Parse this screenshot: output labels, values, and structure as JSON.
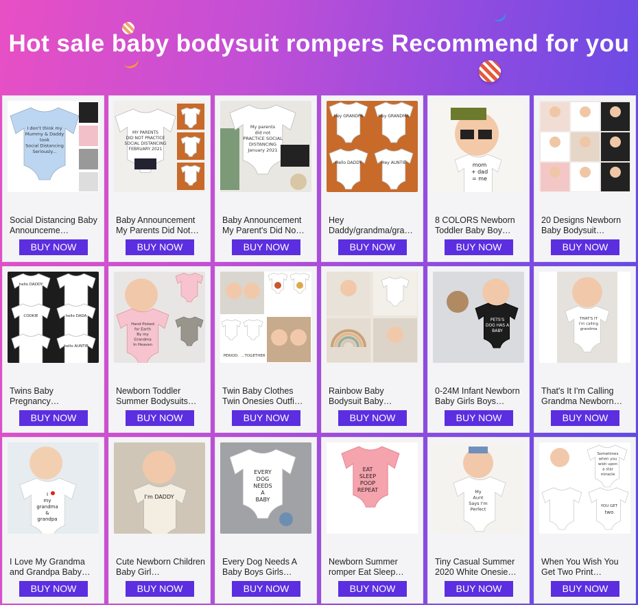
{
  "banner": {
    "title": "Hot sale baby bodysuit rompers Recommend for you",
    "colors": {
      "gradient_start": "#e84fc4",
      "gradient_end": "#5a4be6",
      "button": "#5b2ee0"
    }
  },
  "products": [
    {
      "name": "Social Distancing Baby Announceme…",
      "button": "BUY NOW",
      "image_icon": "product-photo",
      "art": "blue",
      "text": [
        "I don't think my",
        "Mummy & Daddy",
        "took",
        "Social Distancing",
        "Seriously..."
      ]
    },
    {
      "name": "Baby Announcement My Parents Did Not…",
      "button": "BUY NOW",
      "image_icon": "product-photo",
      "art": "white-orange",
      "text": [
        "MY PARENTS",
        "DID NOT PRACTICE",
        "SOCIAL DISTANCING",
        "FEBRUARY 2021"
      ]
    },
    {
      "name": "Baby Announcement My Parent's Did No…",
      "button": "BUY NOW",
      "image_icon": "product-photo",
      "art": "white-leaf",
      "text": [
        "My parents",
        "did not",
        "PRACTICE SOCIAL",
        "DISTANCING",
        "January 2021"
      ]
    },
    {
      "name": "Hey Daddy/grandma/gra…",
      "button": "BUY NOW",
      "image_icon": "product-photo",
      "art": "grid-orange",
      "text": [
        "Hey GRANDPA",
        "Hey GRANDMA",
        "Hello DADDY",
        "Hey AUNTIE"
      ]
    },
    {
      "name": "8 COLORS Newborn Toddler Baby Boy…",
      "button": "BUY NOW",
      "image_icon": "product-photo",
      "art": "baby-glasses",
      "text": [
        "mom",
        "+ dad",
        "= me"
      ]
    },
    {
      "name": "20 Designs Newborn Baby Bodysuit…",
      "button": "BUY NOW",
      "image_icon": "product-photo",
      "art": "collage",
      "text": []
    },
    {
      "name": "Twins Baby Pregnancy…",
      "button": "BUY NOW",
      "image_icon": "product-photo",
      "art": "twins-grid",
      "text": [
        "hello DADDY",
        "COOKIE",
        "hello DADA",
        "hello AUNTIE"
      ]
    },
    {
      "name": "Newborn Toddler Summer Bodysuits…",
      "button": "BUY NOW",
      "image_icon": "product-photo",
      "art": "pink-baby",
      "text": [
        "Hand Picked",
        "for Earth",
        "By my",
        "Grandma",
        "In Heaven"
      ]
    },
    {
      "name": "Twin Baby Clothes Twin Onesies Outfi…",
      "button": "BUY NOW",
      "image_icon": "product-photo",
      "art": "twin-food",
      "text": [
        "PERIOD.",
        "...TOGETHER"
      ]
    },
    {
      "name": "Rainbow Baby Bodysuit Baby…",
      "button": "BUY NOW",
      "image_icon": "product-photo",
      "art": "rainbow",
      "text": []
    },
    {
      "name": "0-24M Infant Newborn Baby Girls Boys…",
      "button": "BUY NOW",
      "image_icon": "product-photo",
      "art": "dog-black",
      "text": [
        "PETS'S",
        "DOG HAS A",
        "BABY"
      ]
    },
    {
      "name": "That's It I'm Calling Grandma Newborn…",
      "button": "BUY NOW",
      "image_icon": "product-photo",
      "art": "white-baby",
      "text": [
        "THAT'S IT",
        "I'm calling",
        "grandma"
      ]
    },
    {
      "name": "I Love My Grandma and Grandpa Baby…",
      "button": "BUY NOW",
      "image_icon": "product-photo",
      "art": "love-grandma",
      "text": [
        "I",
        "my",
        "grandma",
        "&",
        "grandpa"
      ]
    },
    {
      "name": "Cute Newborn Children Baby Girl…",
      "button": "BUY NOW",
      "image_icon": "product-photo",
      "art": "his-daddy",
      "text": [
        "I'm DADDY"
      ]
    },
    {
      "name": "Every Dog Needs A Baby Boys Girls…",
      "button": "BUY NOW",
      "image_icon": "product-photo",
      "art": "dog-baby",
      "text": [
        "EVERY",
        "DOG",
        "NEEDS",
        "A",
        "BABY"
      ]
    },
    {
      "name": "Newborn Summer romper Eat Sleep…",
      "button": "BUY NOW",
      "image_icon": "product-photo",
      "art": "pink-eat",
      "text": [
        "EAT",
        "SLEEP",
        "POOP",
        "REPEAT"
      ]
    },
    {
      "name": "Tiny Casual Summer 2020 White Onesie…",
      "button": "BUY NOW",
      "image_icon": "product-photo",
      "art": "bow-baby",
      "text": [
        "My",
        "Aunt",
        "Says I'm",
        "Perfect"
      ]
    },
    {
      "name": "When You Wish You Get Two Print…",
      "button": "BUY NOW",
      "image_icon": "product-photo",
      "art": "two-wish",
      "text": [
        "Sometimes",
        "when you",
        "wish upon",
        "a star",
        "miracle",
        "YOU GET",
        "two"
      ]
    }
  ]
}
